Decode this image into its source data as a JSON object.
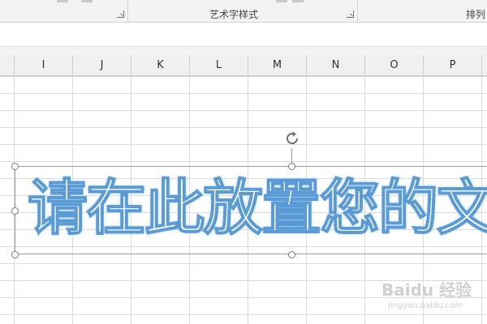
{
  "ribbon": {
    "groups": [
      {
        "label": ""
      },
      {
        "label": "艺术字样式"
      },
      {
        "label": "排列"
      }
    ]
  },
  "columns": [
    "I",
    "J",
    "K",
    "L",
    "M",
    "N",
    "O",
    "P"
  ],
  "wordart": {
    "text": "请在此放置您的文",
    "outline_color": "#5b9bd5",
    "fill_color": "#ffffff"
  },
  "watermark": {
    "brand": "Baidu 经验",
    "url": "jingyan.baidu.com"
  }
}
